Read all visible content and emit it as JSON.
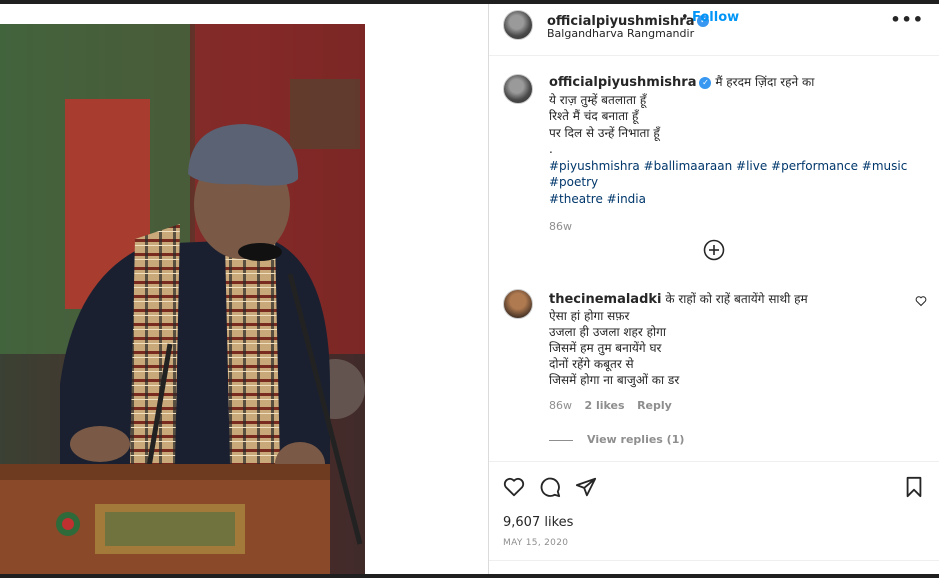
{
  "post": {
    "username": "officialpiyushmishra",
    "follow_label": "Follow",
    "separator": "•",
    "location": "Balgandharva Rangmandir",
    "more_label": "•••"
  },
  "caption": {
    "username": "officialpiyushmishra",
    "lines": [
      "मैं हरदम ज़िंदा रहने का",
      "ये राज़ तुम्हें बतलाता हूँ",
      "रिश्ते मैं चंद बनाता हूँ",
      "पर दिल से उन्हें निभाता हूँ",
      "."
    ],
    "hashtags_line1": "#piyushmishra #ballimaaraan #live #performance #music #poetry",
    "hashtags_line2": "#theatre #india",
    "time": "86w"
  },
  "comment": {
    "username": "thecinemaladki",
    "first_line": "के राहों को राहें बतायेंगे साथी हम",
    "lines": [
      "ऐसा हां होगा सफ़र",
      "उजला ही उजला शहर होगा",
      "जिसमें हम तुम बनायेंगे घर",
      "दोनों रहेंगे कबूतर से",
      "जिसमें होगा ना बाजुओं का डर"
    ],
    "time": "86w",
    "likes": "2 likes",
    "reply": "Reply",
    "view_replies": "View replies (1)"
  },
  "footer": {
    "likes": "9,607 likes",
    "date": "MAY 15, 2020"
  },
  "colors": {
    "link": "#0095f6",
    "hashtag": "#00376b",
    "muted": "#8e8e8e",
    "verified": "#3897f0"
  }
}
